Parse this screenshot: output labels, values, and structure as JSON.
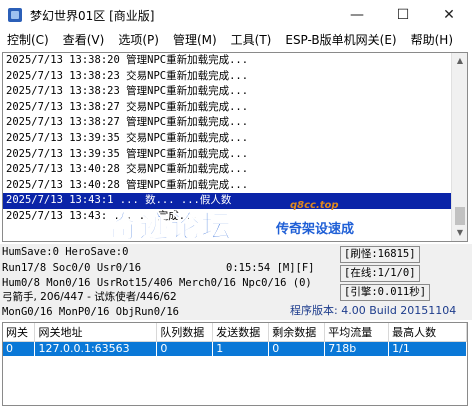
{
  "window": {
    "title": "梦幻世界01区 [商业版]",
    "minimize_glyph": "—",
    "maximize_glyph": "☐",
    "close_glyph": "✕"
  },
  "menu": [
    {
      "label": "控制(C)"
    },
    {
      "label": "查看(V)"
    },
    {
      "label": "选项(P)"
    },
    {
      "label": "管理(M)"
    },
    {
      "label": "工具(T)"
    },
    {
      "label": "ESP-B版单机网关(E)"
    },
    {
      "label": "帮助(H)"
    }
  ],
  "log": [
    {
      "time": "2025/7/13 13:38:20",
      "msg": "管理NPC重新加载完成..."
    },
    {
      "time": "2025/7/13 13:38:23",
      "msg": "交易NPC重新加载完成..."
    },
    {
      "time": "2025/7/13 13:38:23",
      "msg": "管理NPC重新加载完成..."
    },
    {
      "time": "2025/7/13 13:38:27",
      "msg": "交易NPC重新加载完成..."
    },
    {
      "time": "2025/7/13 13:38:27",
      "msg": "管理NPC重新加载完成..."
    },
    {
      "time": "2025/7/13 13:39:35",
      "msg": "交易NPC重新加载完成..."
    },
    {
      "time": "2025/7/13 13:39:35",
      "msg": "管理NPC重新加载完成..."
    },
    {
      "time": "2025/7/13 13:40:28",
      "msg": "交易NPC重新加载完成..."
    },
    {
      "time": "2025/7/13 13:40:28",
      "msg": "管理NPC重新加载完成..."
    },
    {
      "time": "2025/7/13 13:43:1",
      "msg": "...            数...  ...假人数"
    },
    {
      "time": "2025/7/13 13:43:",
      "msg": "...                    ...完成..."
    }
  ],
  "watermark": {
    "main": "奇迹论坛",
    "sub": "传奇架设速成",
    "url": "q8cc.top"
  },
  "status": {
    "line1": "HumSave:0 HeroSave:0",
    "line2a": "Run17/8 Soc0/0 Usr0/16",
    "clock": "0:15:54 [M][F]",
    "line3": "Hum0/8 Mon0/16 UsrRot15/406 Merch0/16 Npc0/16 (0)",
    "line4": "弓箭手, 206/447 - 试炼使者/446/62",
    "line5": "MonG0/16 MonP0/16 ObjRun0/16",
    "refresh": "[刷怪:16815]",
    "online": "[在线:1/1/0]",
    "engine": "[引擎:0.011秒]",
    "version": "程序版本: 4.00 Build 20151104"
  },
  "gateway": {
    "headers": [
      "网关",
      "网关地址",
      "队列数据",
      "发送数据",
      "剩余数据",
      "平均流量",
      "最高人数"
    ],
    "rows": [
      [
        "0",
        "127.0.0.1:63563",
        "0",
        "1",
        "0",
        "718b",
        "1/1"
      ]
    ]
  },
  "colors": {
    "selection": "#0a24a8",
    "table_selection": "#0a78d7",
    "version_text": "#1d3c8c"
  }
}
